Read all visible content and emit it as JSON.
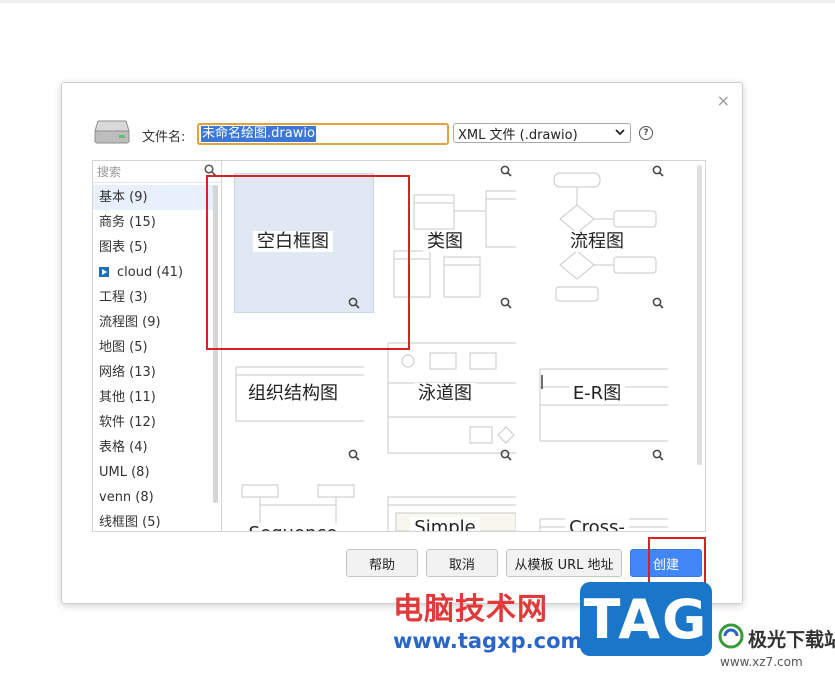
{
  "dialog": {
    "close_symbol": "×",
    "filename_label": "文件名:",
    "filename_value": "未命名绘图.drawio",
    "filetype_value": "XML 文件 (.drawio)",
    "help_symbol": "?",
    "search_placeholder": "搜索",
    "categories": [
      {
        "label": "基本 (9)",
        "selected": true
      },
      {
        "label": "商务 (15)"
      },
      {
        "label": "图表 (5)"
      },
      {
        "label": "cloud (41)",
        "icon": "cloud-expand-icon"
      },
      {
        "label": "工程 (3)"
      },
      {
        "label": "流程图 (9)"
      },
      {
        "label": "地图 (5)"
      },
      {
        "label": "网络 (13)"
      },
      {
        "label": "其他 (11)"
      },
      {
        "label": "软件 (12)"
      },
      {
        "label": "表格 (4)"
      },
      {
        "label": "UML (8)"
      },
      {
        "label": "venn (8)"
      },
      {
        "label": "线框图 (5)"
      }
    ],
    "templates": [
      {
        "label": "空白框图"
      },
      {
        "label": "类图"
      },
      {
        "label": "流程图"
      },
      {
        "label": "组织结构图"
      },
      {
        "label": "泳道图"
      },
      {
        "label": "E-R图"
      },
      {
        "label": "Sequence"
      },
      {
        "label": "Simple"
      },
      {
        "label": "Cross-"
      }
    ],
    "buttons": {
      "help": "帮助",
      "cancel": "取消",
      "from_url": "从模板 URL 地址",
      "create": "创建"
    }
  },
  "watermark": {
    "site_cn": "电脑技术网",
    "site_url": "www.tagxp.com",
    "tag_logo": "TAG",
    "jg_name": "极光下载站",
    "jg_url": "www.xz7.com"
  },
  "colors": {
    "accent": "#4285f4",
    "highlight_box": "#d62222",
    "input_focus": "#e1a33a",
    "selection": "#3b78d8"
  }
}
